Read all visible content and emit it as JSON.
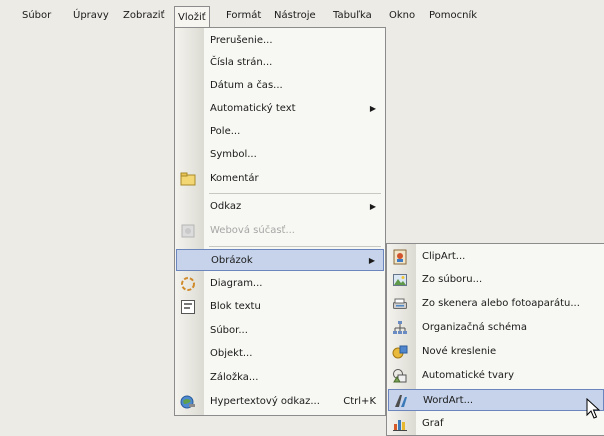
{
  "menubar": {
    "items": [
      "Súbor",
      "Úpravy",
      "Zobraziť",
      "Vložiť",
      "Formát",
      "Nástroje",
      "Tabuľka",
      "Okno",
      "Pomocník"
    ]
  },
  "insert_menu": {
    "items": [
      {
        "label": "Prerušenie...",
        "icon": "none"
      },
      {
        "label": "Čísla strán...",
        "icon": "none"
      },
      {
        "label": "Dátum a čas...",
        "icon": "none"
      },
      {
        "label": "Automatický text",
        "icon": "none",
        "submenu": true
      },
      {
        "label": "Pole...",
        "icon": "none"
      },
      {
        "label": "Symbol...",
        "icon": "none"
      },
      {
        "label": "Komentár",
        "icon": "comment-icon"
      },
      {
        "label": "Odkaz",
        "icon": "none",
        "submenu": true
      },
      {
        "label": "Webová súčasť...",
        "icon": "web-component-icon",
        "disabled": true
      },
      {
        "label": "Obrázok",
        "icon": "none",
        "submenu": true,
        "highlighted": true
      },
      {
        "label": "Diagram...",
        "icon": "diagram-icon"
      },
      {
        "label": "Blok textu",
        "icon": "text-box-icon"
      },
      {
        "label": "Súbor...",
        "icon": "none"
      },
      {
        "label": "Objekt...",
        "icon": "none"
      },
      {
        "label": "Záložka...",
        "icon": "none"
      },
      {
        "label": "Hypertextový odkaz...",
        "icon": "hyperlink-icon",
        "shortcut": "Ctrl+K"
      }
    ]
  },
  "picture_submenu": {
    "items": [
      {
        "label": "ClipArt...",
        "icon": "clipart-icon"
      },
      {
        "label": "Zo súboru...",
        "icon": "from-file-icon"
      },
      {
        "label": "Zo skenera alebo fotoaparátu...",
        "icon": "scanner-icon"
      },
      {
        "label": "Organizačná schéma",
        "icon": "org-chart-icon"
      },
      {
        "label": "Nové kreslenie",
        "icon": "drawing-icon"
      },
      {
        "label": "Automatické tvary",
        "icon": "autoshapes-icon"
      },
      {
        "label": "WordArt...",
        "icon": "wordart-icon",
        "highlighted": true
      },
      {
        "label": "Graf",
        "icon": "chart-icon"
      }
    ]
  }
}
